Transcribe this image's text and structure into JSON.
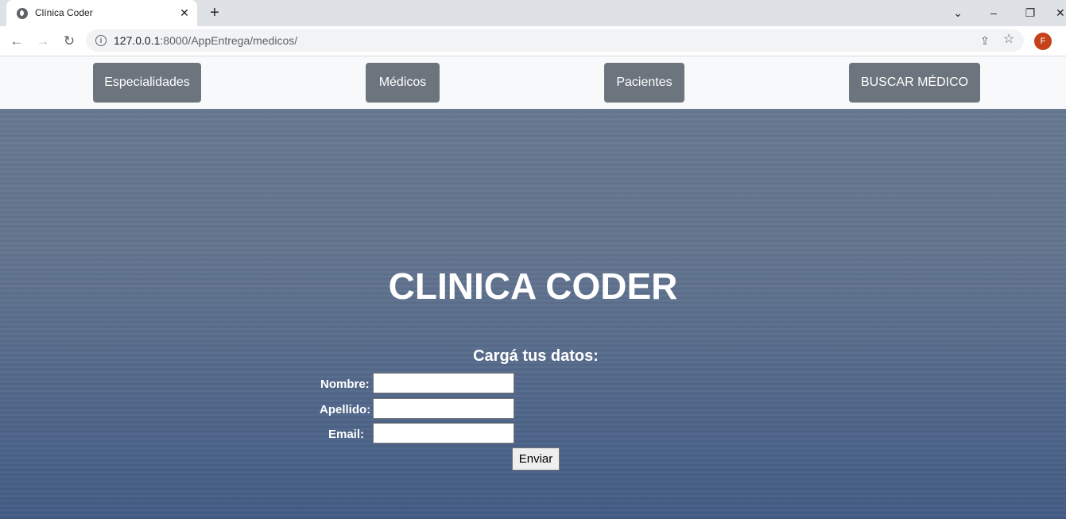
{
  "browser": {
    "tab_title": "Clínica Coder",
    "tab_close": "✕",
    "new_tab": "+",
    "url_host": "127.0.0.1",
    "url_path": ":8000/AppEntrega/medicos/",
    "profile_initial": "F",
    "controls": {
      "tab_search": "⌄",
      "minimize": "–",
      "restore": "❐",
      "close": "✕"
    },
    "nav": {
      "back": "←",
      "forward": "→",
      "reload": "↻"
    },
    "info_symbol": "i",
    "share_symbol": "⇪",
    "star_symbol": "☆"
  },
  "navbar": {
    "items": [
      {
        "label": "Especialidades"
      },
      {
        "label": "Médicos"
      },
      {
        "label": "Pacientes"
      },
      {
        "label": "BUSCAR MÉDICO"
      }
    ]
  },
  "hero": {
    "title": "CLINICA CODER"
  },
  "form": {
    "title": "Cargá tus datos:",
    "nombre_label": "Nombre:",
    "apellido_label": "Apellido:",
    "email_label": "Email:",
    "nombre_value": "",
    "apellido_value": "",
    "email_value": "",
    "submit_label": "Enviar"
  },
  "colors": {
    "navbar_bg": "#f8f9fa",
    "nav_button_bg": "#6c757d",
    "hero_top": "#667891",
    "hero_bottom": "#435b84",
    "avatar_bg": "#c5411a"
  }
}
